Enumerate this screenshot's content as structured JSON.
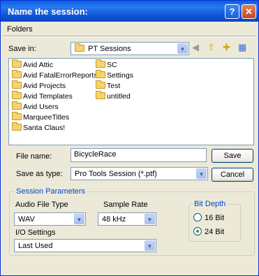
{
  "window": {
    "title": "Name the session:",
    "help_glyph": "?",
    "close_glyph": "✕"
  },
  "folders_label": "Folders",
  "save_in": {
    "label": "Save in:",
    "value": "PT Sessions"
  },
  "nav_icons": [
    "back-icon",
    "up-folder-icon",
    "new-folder-icon",
    "view-menu-icon"
  ],
  "file_list": {
    "column1": [
      "Avid Attic",
      "Avid FatalErrorReports",
      "Avid Projects",
      "Avid Templates",
      "Avid Users",
      "MarqueeTitles",
      "Santa Claus!"
    ],
    "column2": [
      "SC",
      "Settings",
      "Test",
      "untitled"
    ]
  },
  "file_name": {
    "label": "File name:",
    "value": "BicycleRace"
  },
  "save_as_type": {
    "label": "Save as type:",
    "value": "Pro Tools Session (*.ptf)"
  },
  "buttons": {
    "save": "Save",
    "cancel": "Cancel"
  },
  "session_parameters": {
    "title": "Session Parameters",
    "audio_file_type": {
      "label": "Audio File Type",
      "value": "WAV"
    },
    "sample_rate": {
      "label": "Sample Rate",
      "value": "48 kHz"
    },
    "io_settings": {
      "label": "I/O Settings",
      "value": "Last Used"
    },
    "bit_depth": {
      "title": "Bit Depth",
      "options": [
        "16 Bit",
        "24 Bit"
      ],
      "selected": "24 Bit"
    }
  },
  "colors": {
    "titlebar": "#1154d8",
    "dialog_bg": "#ece9d8",
    "group_title": "#0046d5"
  }
}
